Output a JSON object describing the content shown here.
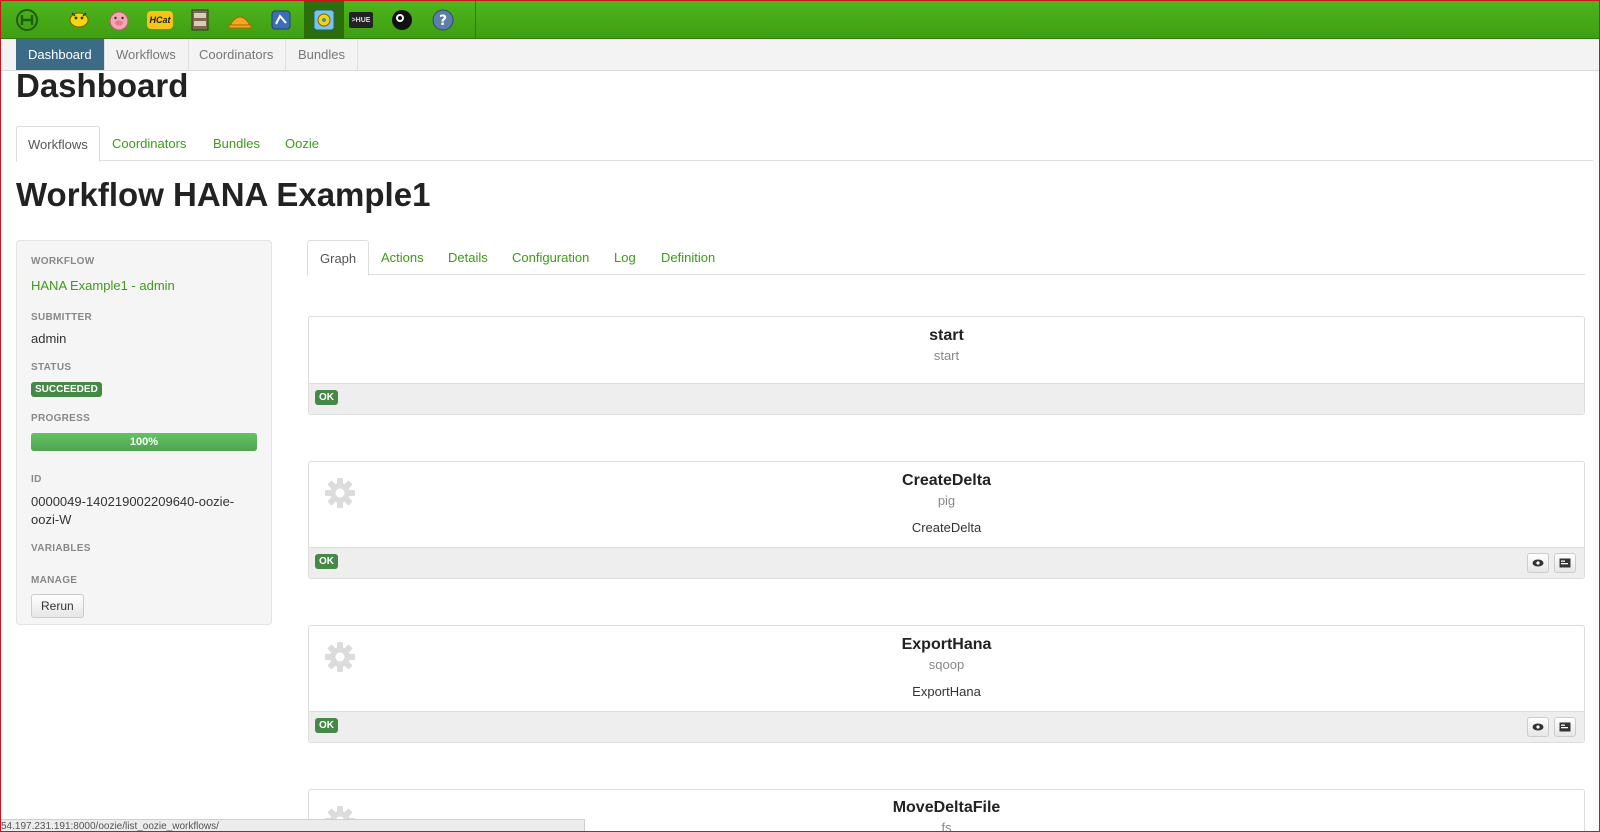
{
  "appbar": {
    "icons": [
      "hue-logo-icon",
      "hive-icon",
      "pig-icon",
      "hcat-icon",
      "file-browser-icon",
      "job-designer-icon",
      "metastore-icon",
      "oozie-icon",
      "shell-icon",
      "user-icon",
      "help-icon"
    ],
    "hcat_label": "HCat",
    "shell_label": ">HUE"
  },
  "subnav": {
    "items": [
      "Dashboard",
      "Workflows",
      "Coordinators",
      "Bundles"
    ]
  },
  "page_title": "Dashboard",
  "main_tabs": [
    "Workflows",
    "Coordinators",
    "Bundles",
    "Oozie"
  ],
  "workflow_title": "Workflow HANA Example1",
  "sidebar": {
    "workflow_label": "WORKFLOW",
    "workflow_value": "HANA Example1 - admin",
    "submitter_label": "SUBMITTER",
    "submitter_value": "admin",
    "status_label": "STATUS",
    "status_value": "SUCCEEDED",
    "progress_label": "PROGRESS",
    "progress_value": "100%",
    "progress_fraction": 1.0,
    "id_label": "ID",
    "id_value_line1": "0000049-140219002209640-oozie-",
    "id_value_line2": "oozi-W",
    "variables_label": "VARIABLES",
    "manage_label": "MANAGE",
    "rerun_label": "Rerun"
  },
  "inner_tabs": [
    "Graph",
    "Actions",
    "Details",
    "Configuration",
    "Log",
    "Definition"
  ],
  "nodes": [
    {
      "name": "start",
      "type": "start",
      "desc": "",
      "status": "OK"
    },
    {
      "name": "CreateDelta",
      "type": "pig",
      "desc": "CreateDelta",
      "status": "OK"
    },
    {
      "name": "ExportHana",
      "type": "sqoop",
      "desc": "ExportHana",
      "status": "OK"
    },
    {
      "name": "MoveDeltaFile",
      "type": "fs",
      "desc": "",
      "status": ""
    }
  ],
  "statusbar_url": "54.197.231.191:8000/oozie/list_oozie_workflows/",
  "colors": {
    "appbar": "#45a816",
    "accent_green": "#3e9a1a",
    "success": "#468847",
    "nav_active": "#3c6b87"
  }
}
